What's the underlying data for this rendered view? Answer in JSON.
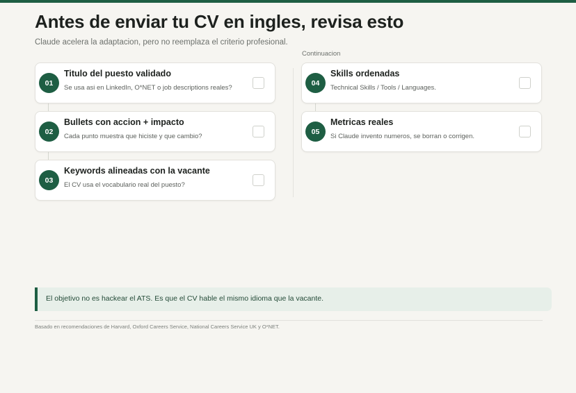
{
  "header": {
    "title": "Antes de enviar tu CV en ingles, revisa esto",
    "subtitle": "Claude acelera la adaptacion, pero no reemplaza el criterio profesional."
  },
  "right_column": {
    "label": "Continuacion"
  },
  "items": [
    {
      "number": "01",
      "title": "Titulo del puesto validado",
      "desc": "Se usa asi en LinkedIn, O*NET o job descriptions reales?",
      "checked": false
    },
    {
      "number": "02",
      "title": "Bullets con accion + impacto",
      "desc": "Cada punto muestra que hiciste y que cambio?",
      "checked": false
    },
    {
      "number": "03",
      "title": "Keywords alineadas con la vacante",
      "desc": "El CV usa el vocabulario real del puesto?",
      "checked": false
    },
    {
      "number": "04",
      "title": "Skills ordenadas",
      "desc": "Technical Skills / Tools / Languages.",
      "checked": false
    },
    {
      "number": "05",
      "title": "Metricas reales",
      "desc": "Si Claude invento numeros, se borran o corrigen.",
      "checked": false
    }
  ],
  "note": {
    "text": "El objetivo no es hackear el ATS. Es que el CV hable el mismo idioma que la vacante."
  },
  "footer": {
    "text": "Basado en recomendaciones de Harvard, Oxford Careers Service, National Careers Service UK y O*NET."
  },
  "colors": {
    "accent": "#1e5e43",
    "note_bg": "#e7efe9",
    "page_bg": "#f6f5f1"
  }
}
